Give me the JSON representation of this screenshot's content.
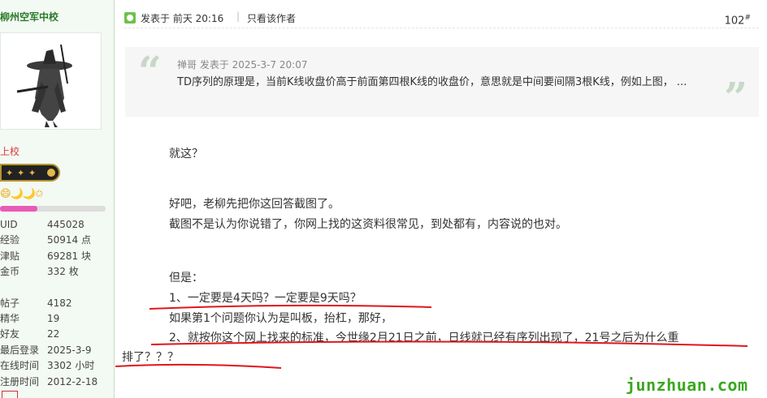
{
  "sidebar": {
    "username": "柳州空军中校",
    "rank_title": "上校",
    "medals": "😄🌙🌙✩",
    "level_progress": 0.35,
    "stats": [
      {
        "label": "UID",
        "value": "445028"
      },
      {
        "label": "经验",
        "value": "50914 点"
      },
      {
        "label": "津贴",
        "value": "69281 块"
      },
      {
        "label": "金币",
        "value": "332 枚"
      }
    ],
    "stats2": [
      {
        "label": "帖子",
        "value": "4182"
      },
      {
        "label": "精华",
        "value": "19"
      },
      {
        "label": "好友",
        "value": "22"
      },
      {
        "label": "最后登录",
        "value": "2025-3-9"
      },
      {
        "label": "在线时间",
        "value": "3302 小时"
      },
      {
        "label": "注册时间",
        "value": "2012-2-18"
      }
    ]
  },
  "post": {
    "posted_at": "发表于 前天 20:16",
    "separator": "|",
    "author_only": "只看该作者",
    "floor": "102",
    "floor_mark": "#",
    "quote": {
      "author_line": "禅哥 发表于 2025-3-7 20:07",
      "text": "TD序列的原理是，当前K线收盘价高于前面第四根K线的收盘价，意思就是中间要间隔3根K线，例如上图， ..."
    },
    "lines": [
      "就这？",
      "好吧，老柳先把你这回答截图了。",
      "截图不是认为你说错了，你网上找的这资料很常见，到处都有，内容说的也对。",
      "但是：",
      "1、一定要是4天吗？一定要是9天吗？",
      "如果第1个问题你认为是叫板，抬杠，那好，",
      "2、就按你这个网上找来的标准，今世缘2月21日之前，日线就已经有序列出现了，21号之后为什么重",
      "排了？？？"
    ]
  },
  "watermark": "junzhuan.com",
  "colors": {
    "username": "#2a7a2a",
    "rank_title": "#d63a3a",
    "annotation_red": "#e0161b",
    "watermark": "#3aa820"
  }
}
